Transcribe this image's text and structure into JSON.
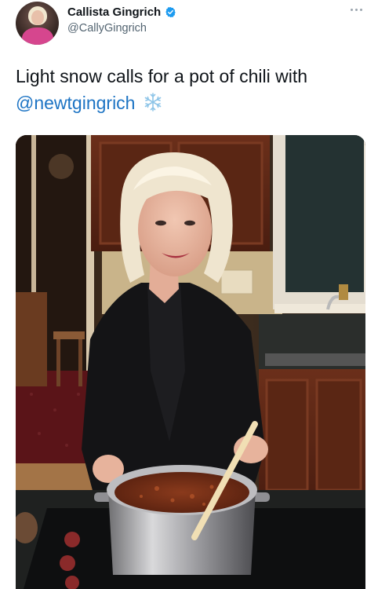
{
  "author": {
    "display_name": "Callista Gingrich",
    "handle": "@CallyGingrich",
    "verified": true,
    "avatar_icon": "profile-photo-icon"
  },
  "tweet": {
    "text": "Light snow calls for a pot of chili with",
    "mention": "@newtgingrich",
    "emoji_icon": "snowflake-icon"
  },
  "media": {
    "kind": "photo",
    "subject": "woman-cooking-chili-icon"
  },
  "colors": {
    "accent": "#1d9bf0",
    "link": "#1d74c4",
    "secondary_text": "#536471"
  }
}
